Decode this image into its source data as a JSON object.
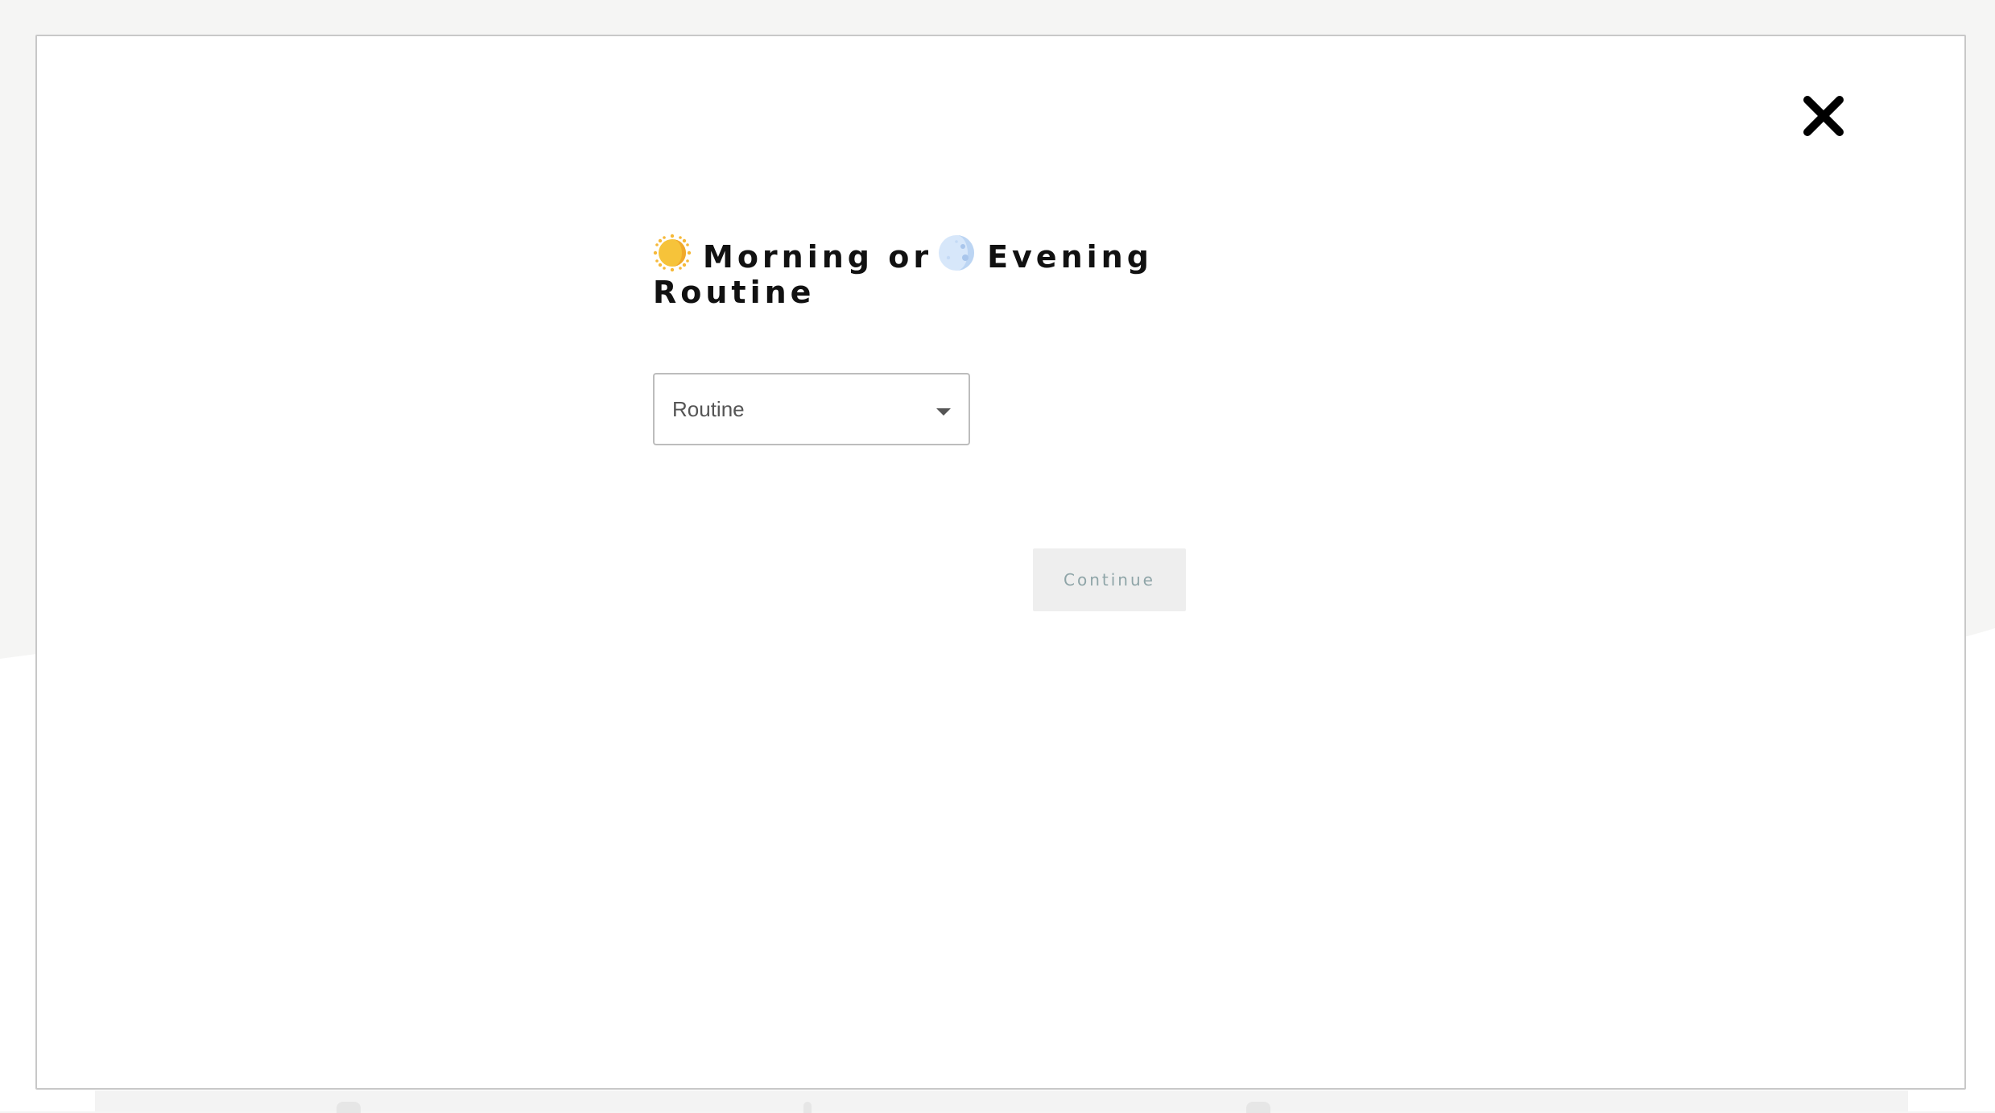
{
  "modal": {
    "title_part1": "Morning or",
    "title_part2": "Evening Routine",
    "morning_icon": "sun-emoji-icon",
    "evening_icon": "moon-emoji-icon",
    "close_icon": "close-icon",
    "select": {
      "placeholder": "Routine",
      "icon": "chevron-down-icon"
    },
    "continue_label": "Continue",
    "continue_enabled": false
  },
  "colors": {
    "page_background": "#f5f5f4",
    "modal_background": "#ffffff",
    "modal_border": "#c8c8c8",
    "title_text": "#111111",
    "button_disabled_bg": "#eeeeee",
    "button_disabled_text": "#8fa5a8",
    "sun": "#f6c33a",
    "moon": "#cfe1f7"
  }
}
